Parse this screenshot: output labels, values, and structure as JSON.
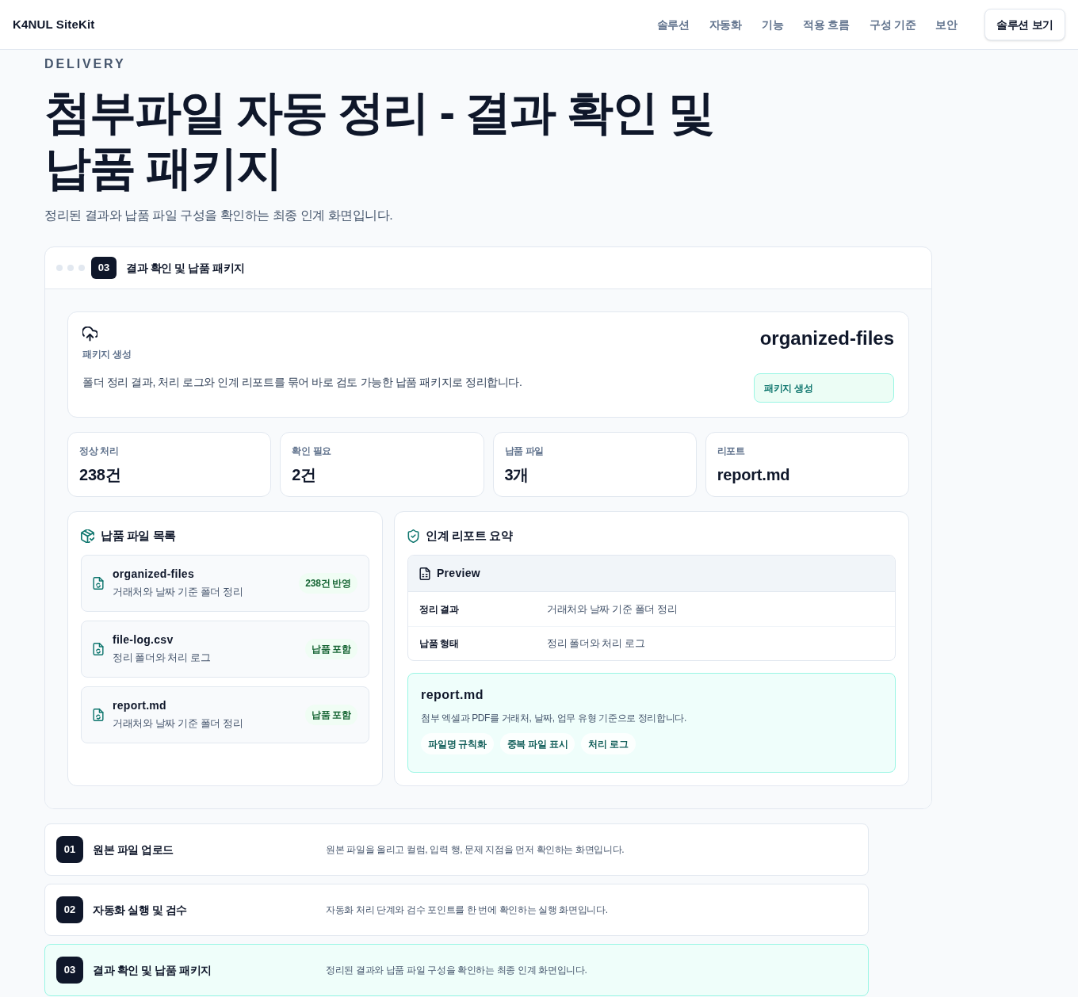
{
  "header": {
    "logo": "K4NUL SiteKit",
    "nav": [
      "솔루션",
      "자동화",
      "기능",
      "적용 흐름",
      "구성 기준",
      "보안"
    ],
    "cta": "솔루션 보기"
  },
  "hero": {
    "eyebrow": "DELIVERY",
    "title": "첨부파일 자동 정리 - 결과 확인 및 납품 패키지",
    "subtitle": "정리된 결과와 납품 파일 구성을 확인하는 최종 인계 화면입니다."
  },
  "window": {
    "step": "03",
    "title": "결과 확인 및 납품 패키지"
  },
  "package": {
    "label": "패키지 생성",
    "description": "폴더 정리 결과, 처리 로그와 인계 리포트를 묶어 바로 검토 가능한 납품 패키지로 정리합니다.",
    "name": "organized-files",
    "status": "패키지 생성"
  },
  "stats": [
    {
      "label": "정상 처리",
      "value": "238건"
    },
    {
      "label": "확인 필요",
      "value": "2건"
    },
    {
      "label": "납품 파일",
      "value": "3개"
    },
    {
      "label": "리포트",
      "value": "report.md"
    }
  ],
  "file_list": {
    "title": "납품 파일 목록",
    "items": [
      {
        "name": "organized-files",
        "description": "거래처와 날짜 기준 폴더 정리",
        "badge": "238건 반영"
      },
      {
        "name": "file-log.csv",
        "description": "정리 폴더와 처리 로그",
        "badge": "납품 포함"
      },
      {
        "name": "report.md",
        "description": "거래처와 날짜 기준 폴더 정리",
        "badge": "납품 포함"
      }
    ]
  },
  "report": {
    "title": "인계 리포트 요약",
    "preview": {
      "title": "Preview",
      "rows": [
        {
          "key": "정리 결과",
          "value": "거래처와 날짜 기준 폴더 정리"
        },
        {
          "key": "납품 형태",
          "value": "정리 폴더와 처리 로그"
        }
      ]
    },
    "file": {
      "name": "report.md",
      "description": "첨부 엑셀과 PDF를 거래처, 날짜, 업무 유형 기준으로 정리합니다.",
      "tags": [
        "파일명 규칙화",
        "중복 파일 표시",
        "처리 로그"
      ]
    }
  },
  "steps": [
    {
      "number": "01",
      "title": "원본 파일 업로드",
      "description": "원본 파일을 올리고 컬럼, 입력 행, 문제 지점을 먼저 확인하는 화면입니다.",
      "selected": false
    },
    {
      "number": "02",
      "title": "자동화 실행 및 검수",
      "description": "자동화 처리 단계와 검수 포인트를 한 번에 확인하는 실행 화면입니다.",
      "selected": false
    },
    {
      "number": "03",
      "title": "결과 확인 및 납품 패키지",
      "description": "정리된 결과와 납품 파일 구성을 확인하는 최종 인계 화면입니다.",
      "selected": true
    }
  ]
}
